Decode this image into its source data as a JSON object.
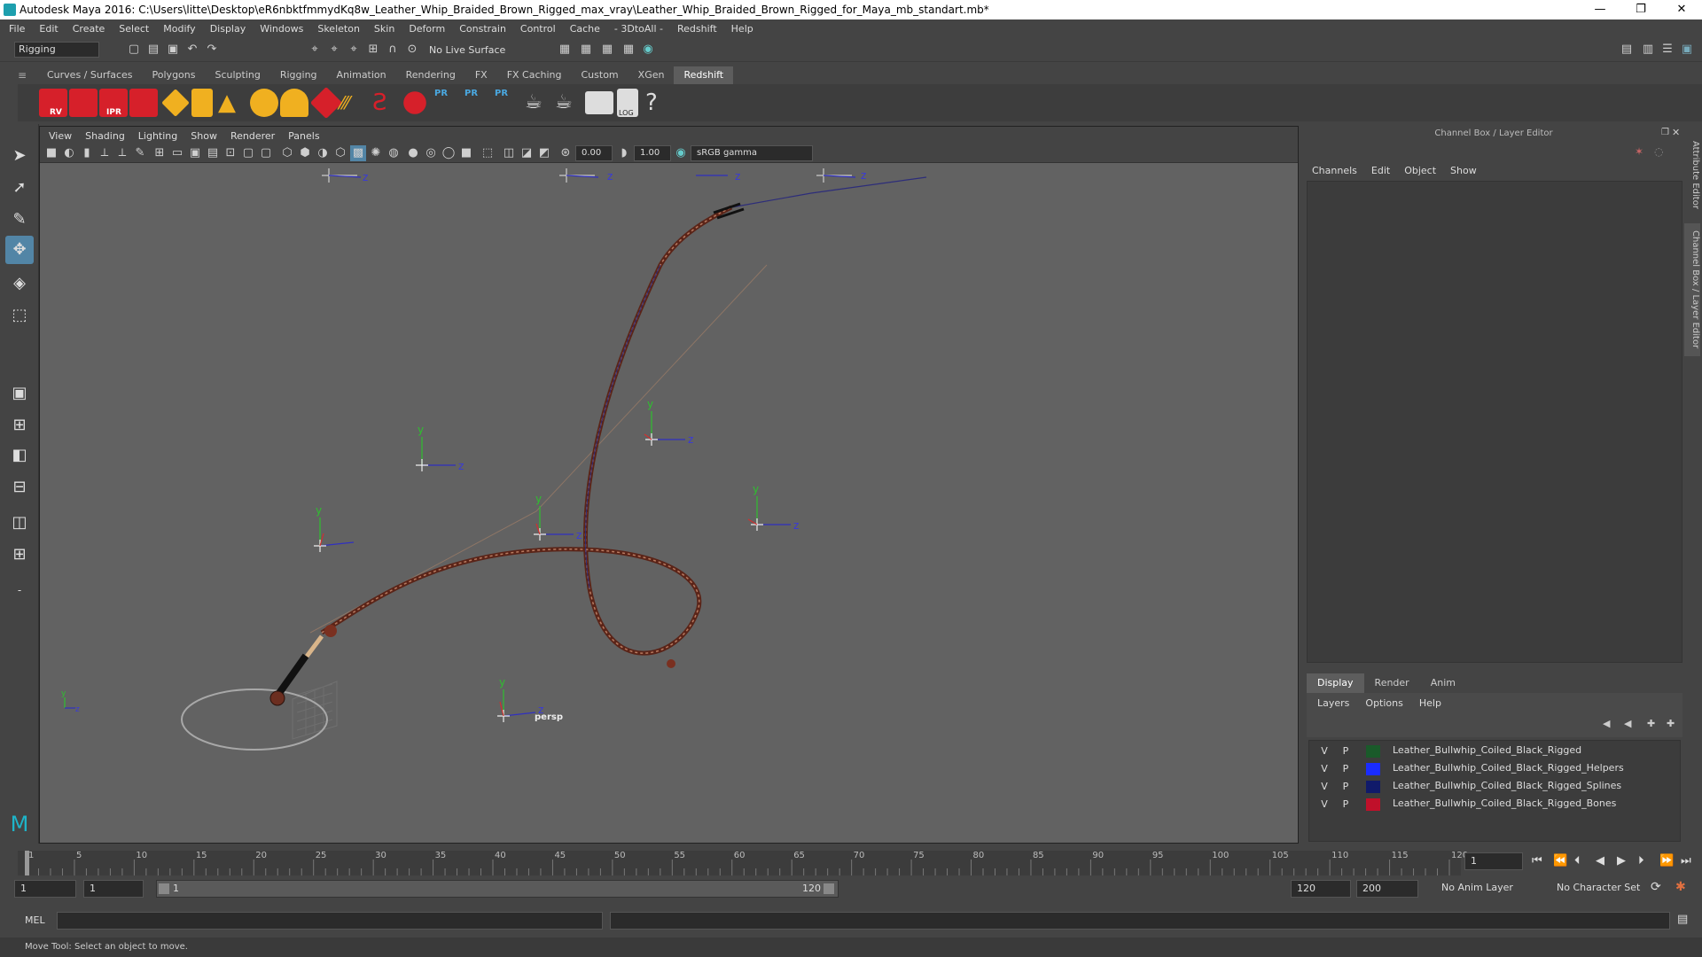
{
  "title": "Autodesk Maya 2016: C:\\Users\\litte\\Desktop\\eR6nbktfmmydKq8w_Leather_Whip_Braided_Brown_Rigged_max_vray\\Leather_Whip_Braided_Brown_Rigged_for_Maya_mb_standart.mb*",
  "window_controls": {
    "minimize": "—",
    "restore": "❐",
    "close": "✕"
  },
  "menubar": [
    "File",
    "Edit",
    "Create",
    "Select",
    "Modify",
    "Display",
    "Windows",
    "Skeleton",
    "Skin",
    "Deform",
    "Constrain",
    "Control",
    "Cache",
    "- 3DtoAll -",
    "Redshift",
    "Help"
  ],
  "status_line": {
    "mode": "Rigging",
    "live_surface": "No Live Surface"
  },
  "shelf_tabs": [
    "Curves / Surfaces",
    "Polygons",
    "Sculpting",
    "Rigging",
    "Animation",
    "Rendering",
    "FX",
    "FX Caching",
    "Custom",
    "XGen",
    "Redshift"
  ],
  "active_shelf": "Redshift",
  "shelf_icons": {
    "rv": "RV",
    "ipr": "IPR",
    "pr1": "PR",
    "pr2": "PR",
    "pr3": "PR",
    "log": "LOG",
    "help": "?"
  },
  "viewport": {
    "menu": [
      "View",
      "Shading",
      "Lighting",
      "Show",
      "Renderer",
      "Panels"
    ],
    "exposure": "0.00",
    "gamma": "1.00",
    "color_space": "sRGB gamma",
    "camera_label": "persp",
    "axis_labels": {
      "x": "x",
      "y": "y",
      "z": "z"
    }
  },
  "channel_box": {
    "header": "Channel Box / Layer Editor",
    "menu": [
      "Channels",
      "Edit",
      "Object",
      "Show"
    ]
  },
  "layer_editor": {
    "tabs": [
      "Display",
      "Render",
      "Anim"
    ],
    "active_tab": "Display",
    "menu": [
      "Layers",
      "Options",
      "Help"
    ],
    "layers": [
      {
        "v": "V",
        "p": "P",
        "color": "#1a5a2a",
        "name": "Leather_Bullwhip_Coiled_Black_Rigged"
      },
      {
        "v": "V",
        "p": "P",
        "color": "#1a2cff",
        "name": "Leather_Bullwhip_Coiled_Black_Rigged_Helpers"
      },
      {
        "v": "V",
        "p": "P",
        "color": "#101a6a",
        "name": "Leather_Bullwhip_Coiled_Black_Rigged_Splines"
      },
      {
        "v": "V",
        "p": "P",
        "color": "#c0102a",
        "name": "Leather_Bullwhip_Coiled_Black_Rigged_Bones"
      }
    ]
  },
  "side_tabs": [
    "Attribute Editor",
    "Channel Box / Layer Editor"
  ],
  "timeline": {
    "ticks": [
      1,
      5,
      10,
      15,
      20,
      25,
      30,
      35,
      40,
      45,
      50,
      55,
      60,
      65,
      70,
      75,
      80,
      85,
      90,
      95,
      100,
      105,
      110,
      115,
      120
    ],
    "current_frame": "1"
  },
  "range": {
    "start": "1",
    "playback_start": "1",
    "slider_start": "1",
    "slider_end": "120",
    "playback_end": "120",
    "end": "200",
    "anim_layer": "No Anim Layer",
    "character_set": "No Character Set"
  },
  "command_line": {
    "lang": "MEL"
  },
  "help_line": "Move Tool: Select an object to move."
}
